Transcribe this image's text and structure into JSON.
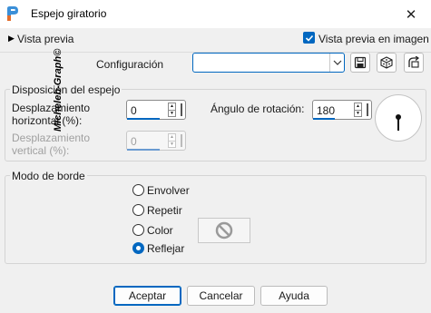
{
  "window": {
    "title": "Espejo giratorio",
    "close_glyph": "✕",
    "app_icon": "paint-palette-icon"
  },
  "preview": {
    "expander_glyph": "▶",
    "label": "Vista previa",
    "checkbox_label": "Vista previa en imagen",
    "checkbox_checked": true
  },
  "config": {
    "label": "Configuración",
    "value": "",
    "tools": [
      "save-icon",
      "random-dice-icon",
      "reset-icon"
    ]
  },
  "mirror_layout": {
    "legend": "Disposición del espejo",
    "h_offset_label_1": "Desplazamiento",
    "h_offset_label_2": "horizontal (%):",
    "h_offset_value": "0",
    "v_offset_label_1": "Desplazamiento",
    "v_offset_label_2": "vertical (%):",
    "v_offset_value": "0",
    "rotation_label": "Ángulo de rotación:",
    "rotation_value": "180"
  },
  "edge_mode": {
    "legend": "Modo de borde",
    "options": [
      "Envolver",
      "Repetir",
      "Color",
      "Reflejar"
    ],
    "selected": "Reflejar"
  },
  "watermark": "Micheleb-Graph©",
  "buttons": {
    "ok": "Aceptar",
    "cancel": "Cancelar",
    "help": "Ayuda"
  },
  "colors": {
    "accent": "#0067c0",
    "background": "#f0f0f0"
  }
}
